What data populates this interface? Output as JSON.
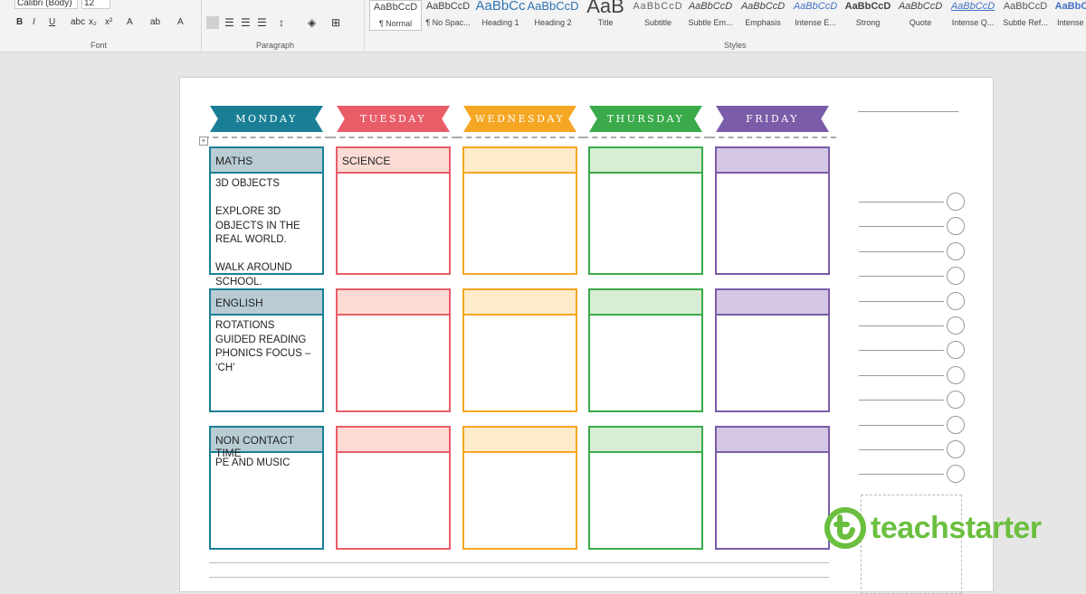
{
  "ribbon": {
    "font_name": "Calibri (Body)",
    "font_size": "12",
    "font_buttons": [
      "B",
      "I",
      "U",
      "abc",
      "x₂",
      "x²",
      "A",
      "ab",
      "A"
    ],
    "groups": [
      "Font",
      "Paragraph",
      "Styles"
    ],
    "styles": [
      {
        "preview": "AaBbCcD",
        "name": "¶ Normal"
      },
      {
        "preview": "AaBbCcD",
        "name": "¶ No Spac..."
      },
      {
        "preview": "AaBbCc",
        "name": "Heading 1"
      },
      {
        "preview": "AaBbCcD",
        "name": "Heading 2"
      },
      {
        "preview": "AaB",
        "name": "Title"
      },
      {
        "preview": "AaBbCcD",
        "name": "Subtitle"
      },
      {
        "preview": "AaBbCcD",
        "name": "Subtle Em..."
      },
      {
        "preview": "AaBbCcD",
        "name": "Emphasis"
      },
      {
        "preview": "AaBbCcD",
        "name": "Intense E..."
      },
      {
        "preview": "AaBbCcD",
        "name": "Strong"
      },
      {
        "preview": "AaBbCcD",
        "name": "Quote"
      },
      {
        "preview": "AaBbCcD",
        "name": "Intense Q..."
      },
      {
        "preview": "AaBbCcD",
        "name": "Subtle Ref..."
      },
      {
        "preview": "AaBbCcD",
        "name": "Intense R..."
      }
    ]
  },
  "days": [
    {
      "label": "MONDAY",
      "color": "#1a7f96",
      "fill": "#b9ccd4"
    },
    {
      "label": "TUESDAY",
      "color": "#e85d68",
      "fill": "#fcdbd5"
    },
    {
      "label": "WEDNESDAY",
      "color": "#f5a623",
      "fill": "#fdebca"
    },
    {
      "label": "THURSDAY",
      "color": "#3aaa4a",
      "fill": "#d7eed4"
    },
    {
      "label": "FRIDAY",
      "color": "#7a5ca8",
      "fill": "#d3c7e4"
    }
  ],
  "cells": [
    [
      {
        "title": "MATHS",
        "body": "3D OBJECTS\n\nEXPLORE 3D OBJECTS IN THE REAL WORLD.\n\nWALK AROUND SCHOOL."
      },
      {
        "title": "SCIENCE",
        "body": ""
      },
      {
        "title": "",
        "body": ""
      },
      {
        "title": "",
        "body": ""
      },
      {
        "title": "",
        "body": ""
      }
    ],
    [
      {
        "title": "ENGLISH",
        "body": "ROTATIONS\nGUIDED READING\nPHONICS FOCUS – ‘CH’"
      },
      {
        "title": "",
        "body": ""
      },
      {
        "title": "",
        "body": ""
      },
      {
        "title": "",
        "body": ""
      },
      {
        "title": "",
        "body": ""
      }
    ],
    [
      {
        "title": "NON CONTACT TIME",
        "body": "PE AND MUSIC"
      },
      {
        "title": "",
        "body": ""
      },
      {
        "title": "",
        "body": ""
      },
      {
        "title": "",
        "body": ""
      },
      {
        "title": "",
        "body": ""
      }
    ]
  ],
  "checklist_count": 12,
  "logo": {
    "text": "teachstarter",
    "color": "#6bbf3f"
  }
}
